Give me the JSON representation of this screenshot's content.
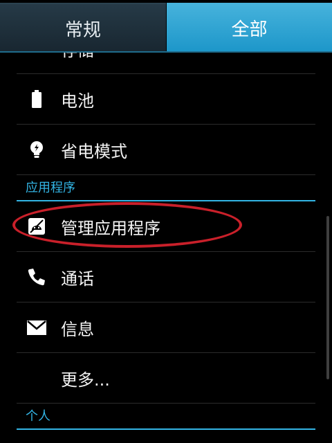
{
  "tabs": {
    "general": "常规",
    "all": "全部"
  },
  "partial_item": {
    "label": "存储",
    "icon": "storage-icon"
  },
  "items": {
    "battery": {
      "label": "电池",
      "icon": "battery-icon"
    },
    "power_saving": {
      "label": "省电模式",
      "icon": "lightbulb-icon"
    },
    "manage_apps": {
      "label": "管理应用程序",
      "icon": "android-apps-icon"
    },
    "calls": {
      "label": "通话",
      "icon": "phone-icon"
    },
    "messages": {
      "label": "信息",
      "icon": "envelope-icon"
    },
    "more": {
      "label": "更多..."
    }
  },
  "sections": {
    "apps": "应用程序",
    "personal": "个人"
  },
  "colors": {
    "accent": "#33b5e5",
    "active_tab": "#33b5e5",
    "annotation": "#c9202a"
  }
}
